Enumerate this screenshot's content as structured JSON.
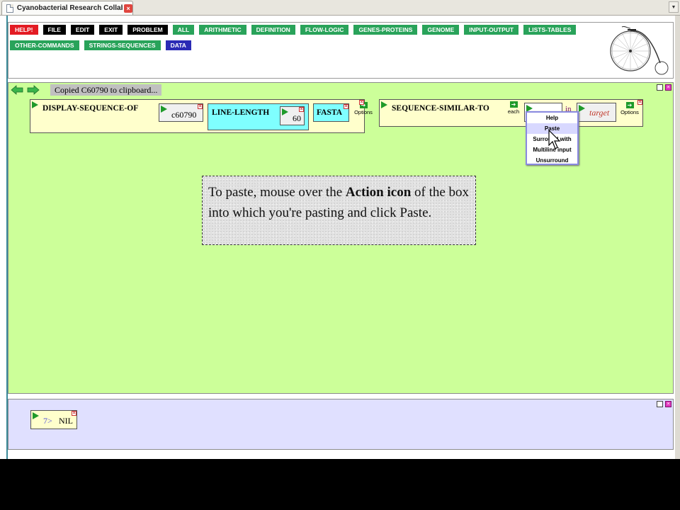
{
  "browser": {
    "tab_title": "Cyanobacterial Research Collabo...",
    "close_glyph": "×",
    "menu_glyph": "▼"
  },
  "toolbar": {
    "row1": [
      {
        "label": "HELP!",
        "color": "red"
      },
      {
        "label": "FILE",
        "color": "black"
      },
      {
        "label": "EDIT",
        "color": "black"
      },
      {
        "label": "EXIT",
        "color": "black"
      },
      {
        "label": "PROBLEM",
        "color": "black"
      },
      {
        "label": "ALL",
        "color": "green"
      },
      {
        "label": "ARITHMETIC",
        "color": "green"
      },
      {
        "label": "DEFINITION",
        "color": "green"
      },
      {
        "label": "FLOW-LOGIC",
        "color": "green"
      },
      {
        "label": "GENES-PROTEINS",
        "color": "green"
      },
      {
        "label": "GENOME",
        "color": "green"
      },
      {
        "label": "INPUT-OUTPUT",
        "color": "green"
      },
      {
        "label": "LISTS-TABLES",
        "color": "green"
      }
    ],
    "row2": [
      {
        "label": "OTHER-COMMANDS",
        "color": "green"
      },
      {
        "label": "STRINGS-SEQUENCES",
        "color": "green"
      },
      {
        "label": "DATA",
        "color": "blue"
      }
    ]
  },
  "workspace": {
    "notice": "Copied C60790 to clipboard...",
    "box1": {
      "function": "DISPLAY-SEQUENCE-OF",
      "arg": "c60790",
      "keyword": "LINE-LENGTH",
      "keyword_value": "60",
      "flag": "FASTA",
      "options": "Options"
    },
    "box2": {
      "function": "SEQUENCE-SIMILAR-TO",
      "each_label": "each",
      "in_label": "in",
      "target": "target",
      "options": "Options"
    },
    "context_menu": {
      "items": [
        "Help",
        "Paste",
        "Surround with",
        "Multiline input",
        "Unsurround"
      ],
      "selected": "Paste"
    },
    "tooltip": {
      "part1": "To paste, mouse over the ",
      "bold": "Action icon",
      "part2": " of the box into which you're pasting and click Paste."
    }
  },
  "results": {
    "prompt": "7>",
    "value": "NIL"
  },
  "colors": {
    "workspace_bg": "#ccff99",
    "results_bg": "#e0e0ff",
    "box_bg": "#ffffcc",
    "cyan": "#7fffff"
  }
}
